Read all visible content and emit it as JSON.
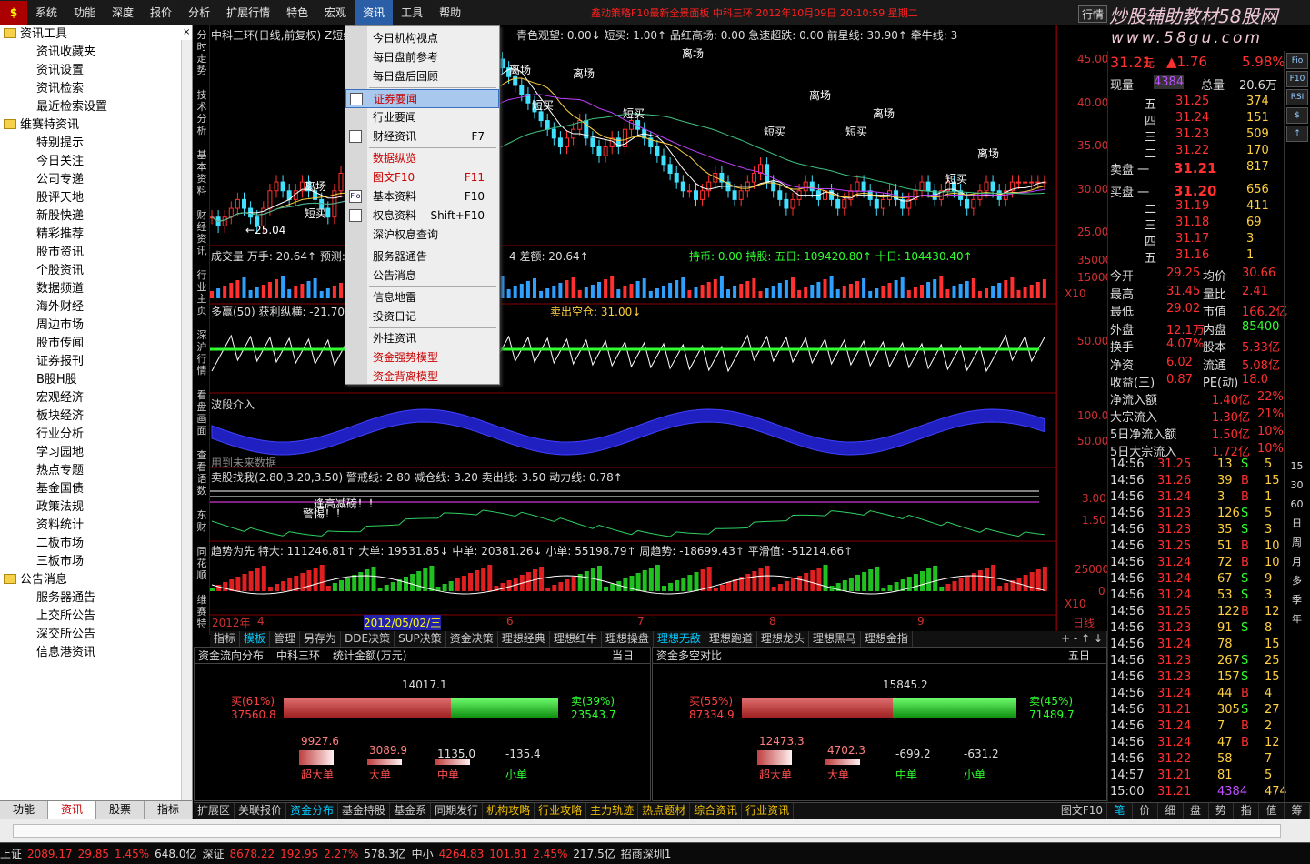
{
  "menu": [
    "系统",
    "功能",
    "深度",
    "报价",
    "分析",
    "扩展行情",
    "特色",
    "宏观",
    "资讯",
    "工具",
    "帮助"
  ],
  "title_info": "鑫动策略F10最新全景面板   中科三环 2012年10月09日 20:10:59 星期二",
  "ctrl_button": "行情",
  "brand": "炒股辅助教材58股网",
  "brand_url": "www.58gu.com",
  "sidebar": {
    "groups": [
      {
        "name": "资讯工具",
        "items": [
          "资讯收藏夹",
          "资讯设置",
          "资讯检索",
          "最近检索设置"
        ]
      },
      {
        "name": "维赛特资讯",
        "items": [
          "特别提示",
          "今日关注",
          "公司专递",
          "股评天地",
          "新股快递",
          "精彩推荐",
          "股市资讯",
          "个股资讯",
          "数据频道",
          "海外财经",
          "周边市场",
          "股市传闻",
          "证券报刊",
          "B股H股",
          "宏观经济",
          "板块经济",
          "行业分析",
          "学习园地",
          "热点专题",
          "基金国债",
          "政策法规",
          "资料统计",
          "二板市场",
          "三板市场"
        ]
      },
      {
        "name": "公告消息",
        "items": [
          "服务器通告",
          "上交所公告",
          "深交所公告",
          "信息港资讯"
        ]
      }
    ],
    "tabs": [
      "功能",
      "资讯",
      "股票",
      "指标"
    ],
    "close": "×"
  },
  "left_labels": [
    "分时走势",
    "技术分析",
    "基本资料",
    "财经资讯",
    "行业主页",
    "深沪行情",
    "看盘画面",
    "查看语数",
    "东财",
    "同花顺",
    "维赛特"
  ],
  "dropdown": {
    "items": [
      {
        "label": "今日机构视点",
        "shortcut": "",
        "style": "normal"
      },
      {
        "label": "每日盘前参考",
        "shortcut": "",
        "style": "normal"
      },
      {
        "label": "每日盘后回顾",
        "shortcut": "",
        "style": "normal"
      },
      {
        "label": "证券要闻",
        "shortcut": "",
        "style": "highlight"
      },
      {
        "label": "行业要闻",
        "shortcut": "",
        "style": "normal"
      },
      {
        "label": "财经资讯",
        "shortcut": "F7",
        "style": "normal"
      },
      {
        "label": "数据纵览",
        "shortcut": "",
        "style": "red"
      },
      {
        "label": "图文F10",
        "shortcut": "F11",
        "style": "red"
      },
      {
        "label": "基本资料",
        "shortcut": "F10",
        "style": "normal"
      },
      {
        "label": "权息资料",
        "shortcut": "Shift+F10",
        "style": "normal"
      },
      {
        "label": "深沪权息查询",
        "shortcut": "",
        "style": "normal"
      },
      {
        "label": "服务器通告",
        "shortcut": "",
        "style": "normal"
      },
      {
        "label": "公告消息",
        "shortcut": "",
        "style": "normal"
      },
      {
        "label": "信息地雷",
        "shortcut": "",
        "style": "normal"
      },
      {
        "label": "投资日记",
        "shortcut": "",
        "style": "normal"
      },
      {
        "label": "外挂资讯",
        "shortcut": "",
        "style": "normal"
      },
      {
        "label": "资金强势模型",
        "shortcut": "",
        "style": "red"
      },
      {
        "label": "资金背离模型",
        "shortcut": "",
        "style": "red"
      }
    ]
  },
  "chart": {
    "main_header": "中科三环(日线,前复权) Z短线",
    "main_header2": "青色观望: 0.00↓   短买: 1.00↑   品红高场: 0.00   急速超跌: 0.00   前星线: 30.90↑   牵牛线: 3",
    "price_axis": [
      "45.00",
      "40.00",
      "35.00",
      "30.00",
      "25.00"
    ],
    "low_label": "←25.04",
    "vol_header": "成交量  万手: 20.64↑  预测: ",
    "vol_header2": "4  差额: 20.64↑",
    "vol_header3": "持币: 0.00  持股:   五日: 109420.80↑  十日: 104430.40↑",
    "vol_axis": [
      "35000",
      "15000",
      "X10"
    ],
    "p3_header": "多赢(50)  获利纵横: -21.70",
    "p3_header2": "卖出空仓: 31.00↓",
    "p3_axis": "50.00",
    "p4_header": "波段介入",
    "p4_axis": [
      "100.0",
      "50.00"
    ],
    "p4_note": "用到未来数据",
    "p5_header": "卖股找我(2.80,3.20,3.50)  警戒线: 2.80  减仓线: 3.20  卖出线: 3.50  动力线: 0.78↑",
    "p5_axis": [
      "3.00",
      "1.50"
    ],
    "p5_text": [
      "逢高减磅！！",
      "警惕！！"
    ],
    "p6_header": "趋势为先  特大: 111246.81↑  大单: 19531.85↓  中单: 20381.26↓  小单: 55198.79↑   周趋势: -18699.43↑  平滑值: -51214.66↑",
    "p6_axis": [
      "25000",
      "0",
      "X10"
    ],
    "date_labels": [
      "2012年",
      "4",
      "2012/05/02/三",
      "6",
      "7",
      "8",
      "9",
      "日线"
    ],
    "signals": [
      "离场",
      "短买"
    ]
  },
  "chart_tabs": [
    "指标",
    "模板",
    "管理",
    "另存为",
    "DDE决策",
    "SUP决策",
    "资金决策",
    "理想经典",
    "理想红牛",
    "理想操盘",
    "理想无敌",
    "理想跑道",
    "理想龙头",
    "理想黑马",
    "理想金指"
  ],
  "panels": [
    {
      "title": "资金流向分布",
      "stock": "中科三环",
      "unit": "统计金额(万元)",
      "period": "当日",
      "total": "14017.1",
      "buy_label": "买(61%)",
      "buy_value": "37560.8",
      "sell_label": "卖(39%)",
      "sell_value": "23543.7",
      "buy_frac": 0.61,
      "cats": [
        {
          "name": "超大单",
          "value": "9927.6"
        },
        {
          "name": "大单",
          "value": "3089.9"
        },
        {
          "name": "中单",
          "value": "1135.0"
        },
        {
          "name": "小单",
          "value": "-135.4"
        }
      ]
    },
    {
      "title": "资金多空对比",
      "stock": "",
      "unit": "",
      "period": "五日",
      "total": "15845.2",
      "buy_label": "买(55%)",
      "buy_value": "87334.9",
      "sell_label": "卖(45%)",
      "sell_value": "71489.7",
      "buy_frac": 0.55,
      "cats": [
        {
          "name": "超大单",
          "value": "12473.3"
        },
        {
          "name": "大单",
          "value": "4702.3"
        },
        {
          "name": "中单",
          "value": "-699.2"
        },
        {
          "name": "小单",
          "value": "-631.2"
        }
      ]
    }
  ],
  "bottom_tabs": [
    "扩展区",
    "关联报价",
    "资金分布",
    "基金持股",
    "基金系",
    "同期发行",
    "机构攻略",
    "行业攻略",
    "主力轨迹",
    "热点题材",
    "综合资讯",
    "行业资讯",
    "图文F10"
  ],
  "quote": {
    "price": "31.21",
    "unit": "元",
    "change": "▲1.76",
    "pct": "5.98%",
    "now_label": "现量",
    "now": "4384",
    "total_label": "总量",
    "total": "20.6万",
    "sell": [
      {
        "l": "五",
        "p": "31.25",
        "v": "374"
      },
      {
        "l": "四",
        "p": "31.24",
        "v": "151"
      },
      {
        "l": "三",
        "p": "31.23",
        "v": "509"
      },
      {
        "l": "二",
        "p": "31.22",
        "v": "170"
      },
      {
        "l": "卖盘 一",
        "p": "31.21",
        "v": "817"
      }
    ],
    "buy": [
      {
        "l": "买盘 一",
        "p": "31.20",
        "v": "656"
      },
      {
        "l": "二",
        "p": "31.19",
        "v": "411"
      },
      {
        "l": "三",
        "p": "31.18",
        "v": "69"
      },
      {
        "l": "四",
        "p": "31.17",
        "v": "3"
      },
      {
        "l": "五",
        "p": "31.16",
        "v": "1"
      }
    ],
    "stats": [
      [
        "今开",
        "29.25",
        "均价",
        "30.66"
      ],
      [
        "最高",
        "31.45",
        "量比",
        "2.41"
      ],
      [
        "最低",
        "29.02",
        "市值",
        "166.2亿"
      ],
      [
        "外盘",
        "12.1万",
        "内盘",
        "85400"
      ],
      [
        "换手",
        "4.07%",
        "股本",
        "5.33亿"
      ],
      [
        "净资",
        "6.02",
        "流通",
        "5.08亿"
      ],
      [
        "收益(三)",
        "0.87",
        "PE(动)",
        "18.0"
      ]
    ],
    "flows": [
      [
        "净流入额",
        "1.40亿",
        "22%"
      ],
      [
        "大宗流入",
        "1.30亿",
        "21%"
      ],
      [
        "5日净流入额",
        "1.50亿",
        "10%"
      ],
      [
        "5日大宗流入",
        "1.72亿",
        "10%"
      ]
    ],
    "ticks": [
      [
        "14:56",
        "31.25",
        "13",
        "S",
        "5"
      ],
      [
        "14:56",
        "31.26",
        "39",
        "B",
        "15"
      ],
      [
        "14:56",
        "31.24",
        "3",
        "B",
        "1"
      ],
      [
        "14:56",
        "31.23",
        "126",
        "S",
        "5"
      ],
      [
        "14:56",
        "31.23",
        "35",
        "S",
        "3"
      ],
      [
        "14:56",
        "31.25",
        "51",
        "B",
        "10"
      ],
      [
        "14:56",
        "31.24",
        "72",
        "B",
        "10"
      ],
      [
        "14:56",
        "31.24",
        "67",
        "S",
        "9"
      ],
      [
        "14:56",
        "31.24",
        "53",
        "S",
        "3"
      ],
      [
        "14:56",
        "31.25",
        "122",
        "B",
        "12"
      ],
      [
        "14:56",
        "31.23",
        "91",
        "S",
        "8"
      ],
      [
        "14:56",
        "31.24",
        "78",
        "",
        "15"
      ],
      [
        "14:56",
        "31.23",
        "267",
        "S",
        "25"
      ],
      [
        "14:56",
        "31.23",
        "157",
        "S",
        "15"
      ],
      [
        "14:56",
        "31.24",
        "44",
        "B",
        "4"
      ],
      [
        "14:56",
        "31.21",
        "305",
        "S",
        "27"
      ],
      [
        "14:56",
        "31.24",
        "7",
        "B",
        "2"
      ],
      [
        "14:56",
        "31.24",
        "47",
        "B",
        "12"
      ],
      [
        "14:56",
        "31.22",
        "58",
        "",
        "7"
      ],
      [
        "14:57",
        "31.21",
        "81",
        "",
        "5"
      ],
      [
        "15:00",
        "31.21",
        "4384",
        "",
        "474"
      ]
    ],
    "side_col": [
      "15",
      "30",
      "60",
      "日",
      "周",
      "月",
      "多",
      "季",
      "年"
    ],
    "bottom": [
      "笔",
      "价",
      "细",
      "盘",
      "势",
      "指",
      "值",
      "筹"
    ],
    "tools": [
      "Fio",
      "F10",
      "RSI",
      "$",
      "↑"
    ]
  },
  "status": [
    {
      "t": "上证",
      "c": "#ddd"
    },
    {
      "t": "2089.17",
      "c": "#ff3030"
    },
    {
      "t": "29.85",
      "c": "#ff3030"
    },
    {
      "t": "1.45%",
      "c": "#ff3030"
    },
    {
      "t": "648.0亿",
      "c": "#ddd"
    },
    {
      "t": "深证",
      "c": "#ddd"
    },
    {
      "t": "8678.22",
      "c": "#ff3030"
    },
    {
      "t": "192.95",
      "c": "#ff3030"
    },
    {
      "t": "2.27%",
      "c": "#ff3030"
    },
    {
      "t": "578.3亿",
      "c": "#ddd"
    },
    {
      "t": "中小",
      "c": "#ddd"
    },
    {
      "t": "4264.83",
      "c": "#ff3030"
    },
    {
      "t": "101.81",
      "c": "#ff3030"
    },
    {
      "t": "2.45%",
      "c": "#ff3030"
    },
    {
      "t": "217.5亿",
      "c": "#ddd"
    },
    {
      "t": "招商深圳1",
      "c": "#ddd"
    }
  ]
}
